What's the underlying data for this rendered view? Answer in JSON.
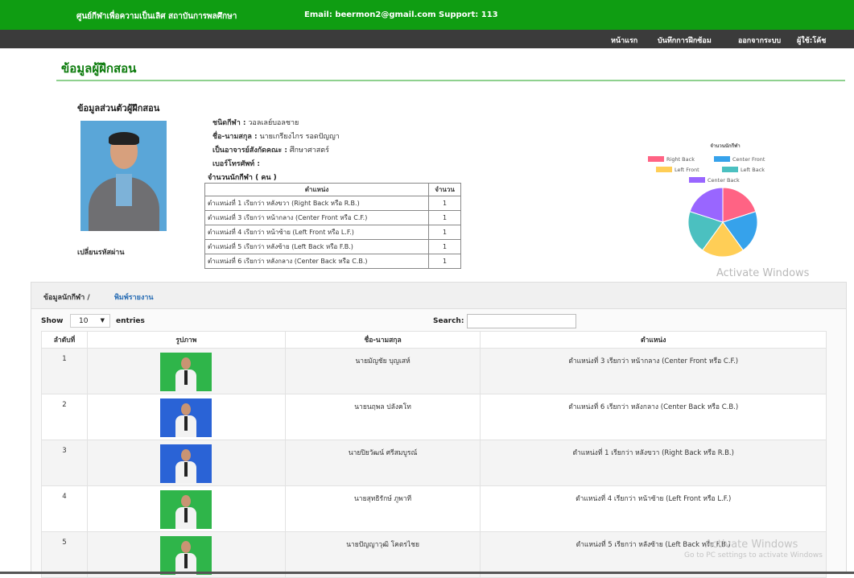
{
  "topbar": {
    "brand": "ศูนย์กีฬาเพื่อความเป็นเลิศ สถาบันการพลศึกษา",
    "contact": "Email: beermon2@gmail.com   Support: 113"
  },
  "nav": {
    "items": [
      "หน้าแรก",
      "บันทึกการฝึกซ้อม",
      "ออกจากระบบ",
      "ผู้ใช้:โค้ช"
    ]
  },
  "page": {
    "title": "ข้อมูลผู้ฝึกสอน",
    "section_title": "ข้อมูลส่วนตัวผู้ฝึกสอน",
    "change_password": "เปลี่ยนรหัสผ่าน"
  },
  "profile": {
    "sport_label": "ชนิดกีฬา :",
    "sport": "วอลเลย์บอลชาย",
    "name_label": "ชื่อ-นามสกุล :",
    "name": "นายเกรียงไกร รอดปัญญา",
    "faculty_label": "เป็นอาจารย์สังกัดคณะ :",
    "faculty": "ศึกษาศาสตร์",
    "phone_label": "เบอร์โทรศัพท์ :",
    "phone": ""
  },
  "position_table": {
    "caption": "จำนวนนักกีฬา ( คน )",
    "headers": [
      "ตำแหน่ง",
      "จำนวน"
    ],
    "rows": [
      [
        "ตำแหน่งที่ 1 เรียกว่า หลังขวา (Right Back หรือ R.B.)",
        "1"
      ],
      [
        "ตำแหน่งที่ 3 เรียกว่า หน้ากลาง (Center Front หรือ C.F.)",
        "1"
      ],
      [
        "ตำแหน่งที่ 4 เรียกว่า หน้าซ้าย (Left Front หรือ L.F.)",
        "1"
      ],
      [
        "ตำแหน่งที่ 5 เรียกว่า หลังซ้าย (Left Back หรือ F.B.)",
        "1"
      ],
      [
        "ตำแหน่งที่ 6 เรียกว่า หลังกลาง (Center Back หรือ C.B.)",
        "1"
      ]
    ]
  },
  "chart_data": {
    "type": "pie",
    "title": "จำนวนนักกีฬา",
    "legend_position": "top",
    "categories": [
      "Right Back",
      "Center Front",
      "Left Front",
      "Left Back",
      "Center Back"
    ],
    "values": [
      1,
      1,
      1,
      1,
      1
    ],
    "colors": [
      "#ff6384",
      "#36a2eb",
      "#ffce56",
      "#4bc0c0",
      "#9966ff"
    ]
  },
  "panel": {
    "title": "ข้อมูลนักกีฬา /",
    "print_link": "พิมพ์รายงาน",
    "show_label": "Show",
    "entries_value": "10",
    "entries_label": "entries",
    "search_label": "Search:",
    "search_value": ""
  },
  "athletes_table": {
    "headers": [
      "ลำดับที่",
      "รูปภาพ",
      "ชื่อ-นามสกุล",
      "ตำแหน่ง"
    ],
    "rows": [
      {
        "no": "1",
        "photo_bg": "#2fb54a",
        "name": "นายมัญชัย บุญเสห์",
        "position": "ตำแหน่งที่ 3 เรียกว่า หน้ากลาง (Center Front หรือ C.F.)"
      },
      {
        "no": "2",
        "photo_bg": "#2a63d6",
        "name": "นายนฤพล ปลังคโท",
        "position": "ตำแหน่งที่ 6 เรียกว่า หลังกลาง (Center Back หรือ C.B.)"
      },
      {
        "no": "3",
        "photo_bg": "#2a63d6",
        "name": "นายปิยวัฒน์ ศรีสมบูรณ์",
        "position": "ตำแหน่งที่ 1 เรียกว่า หลังขวา (Right Back หรือ R.B.)"
      },
      {
        "no": "4",
        "photo_bg": "#2fb54a",
        "name": "นายสุทธิรักษ์ ภูพาที",
        "position": "ตำแหน่งที่ 4 เรียกว่า หน้าซ้าย (Left Front หรือ L.F.)"
      },
      {
        "no": "5",
        "photo_bg": "#2fb54a",
        "name": "นายปัญญาวุฒิ โคตรไชย",
        "position": "ตำแหน่งที่ 5 เรียกว่า หลังซ้าย (Left Back หรือ F.B.)"
      }
    ]
  },
  "watermark": {
    "line1": "Activate Windows",
    "line2": "Go to PC settings to activate Windows"
  }
}
